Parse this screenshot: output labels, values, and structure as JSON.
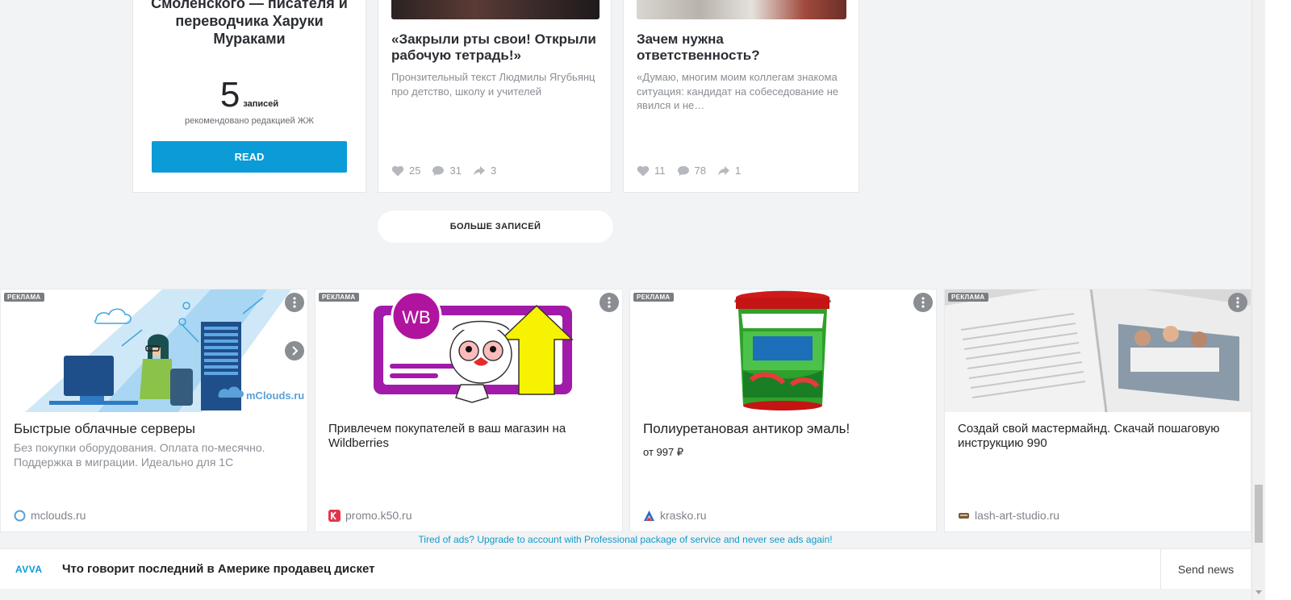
{
  "blog_card": {
    "title": "Смоленского — писателя и переводчика Харуки Мураками",
    "count": "5",
    "count_word": "записей",
    "recommended": "рекомендовано редакцией ЖЖ",
    "read_button": "READ"
  },
  "posts": [
    {
      "title": "«Закрыли рты свои! Открыли рабочую тетрадь!»",
      "text": "Пронзительный текст Людмилы Ягубьянц про детство, школу и учителей",
      "likes": "25",
      "comments": "31",
      "shares": "3"
    },
    {
      "title": "Зачем нужна ответственность?",
      "text": "«Думаю, многим моим коллегам знакома ситуация: кандидат на собеседование не явился и не…",
      "likes": "11",
      "comments": "78",
      "shares": "1"
    }
  ],
  "more_button": "БОЛЬШЕ ЗАПИСЕЙ",
  "ad_label": "РЕКЛАМА",
  "ads": [
    {
      "title": "Быстрые облачные серверы",
      "desc": "Без покупки оборудования. Оплата по-месячно. Поддержка в миграции. Идеально для 1С",
      "domain": "mclouds.ru",
      "image_logo": "mClouds.ru"
    },
    {
      "title": "Привлечем покупателей в ваш магазин на Wildberries",
      "domain": "promo.k50.ru",
      "image_logo": "WB"
    },
    {
      "title": "Полиуретановая антикор эмаль!",
      "price": "от 997 ₽",
      "domain": "krasko.ru"
    },
    {
      "title": "Создай свой мастермайнд. Скачай пошаговую инструкцию 990",
      "domain": "lash-art-studio.ru"
    }
  ],
  "ad_notice": "Tired of ads? Upgrade to account with Professional package of service and never see ads again!",
  "bottom_bar": {
    "brand": "AVVA",
    "news_title": "Что говорит последний в Америке продавец дискет",
    "send_news": "Send news"
  },
  "colors": {
    "accent": "#0b9bd7",
    "background": "#f2f3f5",
    "ad_label": "#7a7d82"
  }
}
